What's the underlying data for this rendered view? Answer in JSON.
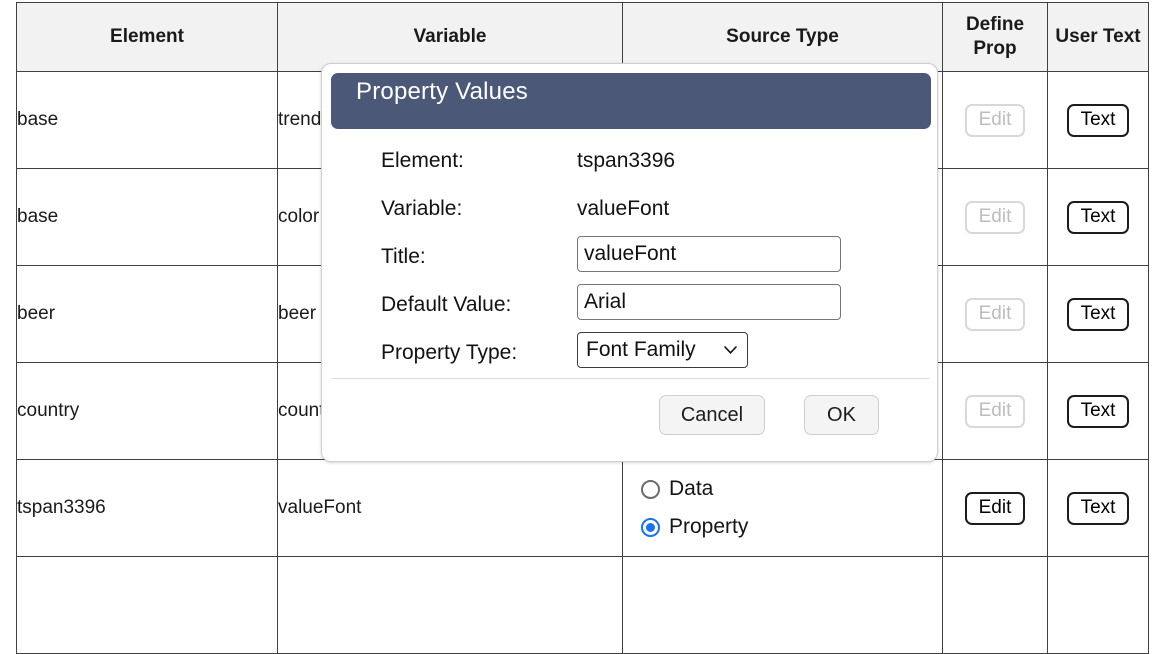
{
  "table": {
    "columns": [
      {
        "key": "element",
        "label": "Element"
      },
      {
        "key": "variable",
        "label": "Variable"
      },
      {
        "key": "source",
        "label": "Source Type"
      },
      {
        "key": "define",
        "label": "Define Prop"
      },
      {
        "key": "usertext",
        "label": "User Text"
      }
    ],
    "rows": [
      {
        "element": "base",
        "variable": "trend",
        "define_label": "Edit",
        "define_enabled": false,
        "usertext_label": "Text"
      },
      {
        "element": "base",
        "variable": "color",
        "define_label": "Edit",
        "define_enabled": false,
        "usertext_label": "Text"
      },
      {
        "element": "beer",
        "variable": "beer",
        "define_label": "Edit",
        "define_enabled": false,
        "usertext_label": "Text"
      },
      {
        "element": "country",
        "variable": "country",
        "define_label": "Edit",
        "define_enabled": false,
        "usertext_label": "Text"
      },
      {
        "element": "tspan3396",
        "variable": "valueFont",
        "define_label": "Edit",
        "define_enabled": true,
        "usertext_label": "Text"
      }
    ],
    "source_type_options": [
      {
        "label": "Data",
        "selected": false
      },
      {
        "label": "Property",
        "selected": true
      }
    ]
  },
  "dialog": {
    "title": "Property Values",
    "titlebar_color": "#4c5878",
    "fields": {
      "element_label": "Element:",
      "element_value": "tspan3396",
      "variable_label": "Variable:",
      "variable_value": "valueFont",
      "title_label": "Title:",
      "title_value": "valueFont",
      "title_placeholder": "",
      "default_value_label": "Default Value:",
      "default_value_value": "Arial",
      "default_value_placeholder": "",
      "property_type_label": "Property Type:",
      "property_type_value": "Font Family",
      "property_type_options": [
        "Font Family"
      ]
    },
    "buttons": {
      "cancel": "Cancel",
      "ok": "OK"
    },
    "accent_selected": "#1a73e8"
  }
}
